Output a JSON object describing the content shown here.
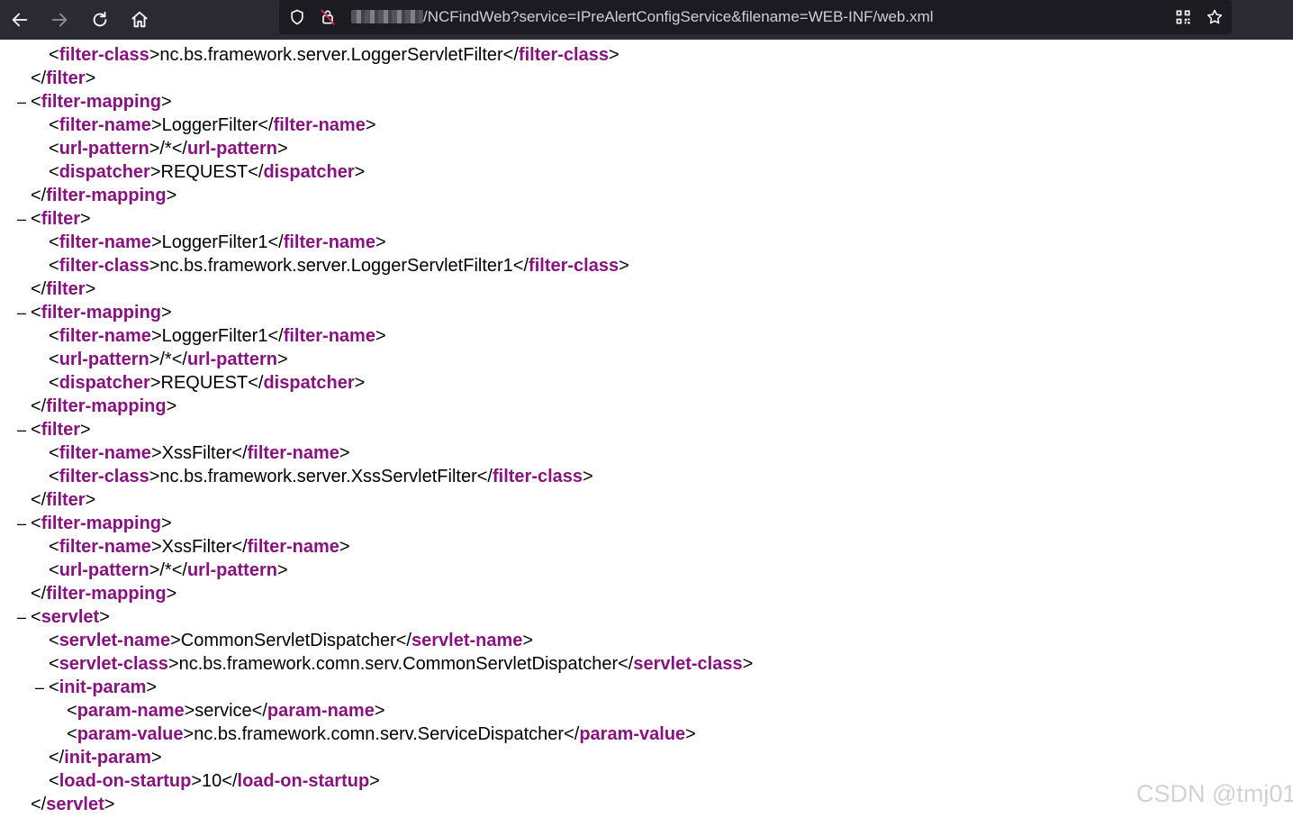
{
  "browser": {
    "url_prefix_redacted": "",
    "url": "/NCFindWeb?service=IPreAlertConfigService&filename=WEB-INF/web.xml"
  },
  "icons": [
    "back-arrow-icon",
    "forward-arrow-icon",
    "reload-icon",
    "home-icon",
    "shield-icon",
    "lock-crossed-icon",
    "qr-code-icon",
    "bookmark-star-icon"
  ],
  "xml_lines": [
    {
      "indent": 1,
      "fold": "",
      "parts": [
        [
          "t",
          "<"
        ],
        [
          "g",
          "filter-class"
        ],
        [
          "t",
          ">nc.bs.framework.server.LoggerServletFilter</"
        ],
        [
          "g",
          "filter-class"
        ],
        [
          "t",
          ">"
        ]
      ]
    },
    {
      "indent": 0,
      "fold": "",
      "parts": [
        [
          "t",
          "</"
        ],
        [
          "g",
          "filter"
        ],
        [
          "t",
          ">"
        ]
      ]
    },
    {
      "indent": 0,
      "fold": "–",
      "parts": [
        [
          "t",
          "<"
        ],
        [
          "g",
          "filter-mapping"
        ],
        [
          "t",
          ">"
        ]
      ]
    },
    {
      "indent": 1,
      "fold": "",
      "parts": [
        [
          "t",
          "<"
        ],
        [
          "g",
          "filter-name"
        ],
        [
          "t",
          ">LoggerFilter</"
        ],
        [
          "g",
          "filter-name"
        ],
        [
          "t",
          ">"
        ]
      ]
    },
    {
      "indent": 1,
      "fold": "",
      "parts": [
        [
          "t",
          "<"
        ],
        [
          "g",
          "url-pattern"
        ],
        [
          "t",
          ">/*</"
        ],
        [
          "g",
          "url-pattern"
        ],
        [
          "t",
          ">"
        ]
      ]
    },
    {
      "indent": 1,
      "fold": "",
      "parts": [
        [
          "t",
          "<"
        ],
        [
          "g",
          "dispatcher"
        ],
        [
          "t",
          ">REQUEST</"
        ],
        [
          "g",
          "dispatcher"
        ],
        [
          "t",
          ">"
        ]
      ]
    },
    {
      "indent": 0,
      "fold": "",
      "parts": [
        [
          "t",
          "</"
        ],
        [
          "g",
          "filter-mapping"
        ],
        [
          "t",
          ">"
        ]
      ]
    },
    {
      "indent": 0,
      "fold": "–",
      "parts": [
        [
          "t",
          "<"
        ],
        [
          "g",
          "filter"
        ],
        [
          "t",
          ">"
        ]
      ]
    },
    {
      "indent": 1,
      "fold": "",
      "parts": [
        [
          "t",
          "<"
        ],
        [
          "g",
          "filter-name"
        ],
        [
          "t",
          ">LoggerFilter1</"
        ],
        [
          "g",
          "filter-name"
        ],
        [
          "t",
          ">"
        ]
      ]
    },
    {
      "indent": 1,
      "fold": "",
      "parts": [
        [
          "t",
          "<"
        ],
        [
          "g",
          "filter-class"
        ],
        [
          "t",
          ">nc.bs.framework.server.LoggerServletFilter1</"
        ],
        [
          "g",
          "filter-class"
        ],
        [
          "t",
          ">"
        ]
      ]
    },
    {
      "indent": 0,
      "fold": "",
      "parts": [
        [
          "t",
          "</"
        ],
        [
          "g",
          "filter"
        ],
        [
          "t",
          ">"
        ]
      ]
    },
    {
      "indent": 0,
      "fold": "–",
      "parts": [
        [
          "t",
          "<"
        ],
        [
          "g",
          "filter-mapping"
        ],
        [
          "t",
          ">"
        ]
      ]
    },
    {
      "indent": 1,
      "fold": "",
      "parts": [
        [
          "t",
          "<"
        ],
        [
          "g",
          "filter-name"
        ],
        [
          "t",
          ">LoggerFilter1</"
        ],
        [
          "g",
          "filter-name"
        ],
        [
          "t",
          ">"
        ]
      ]
    },
    {
      "indent": 1,
      "fold": "",
      "parts": [
        [
          "t",
          "<"
        ],
        [
          "g",
          "url-pattern"
        ],
        [
          "t",
          ">/*</"
        ],
        [
          "g",
          "url-pattern"
        ],
        [
          "t",
          ">"
        ]
      ]
    },
    {
      "indent": 1,
      "fold": "",
      "parts": [
        [
          "t",
          "<"
        ],
        [
          "g",
          "dispatcher"
        ],
        [
          "t",
          ">REQUEST</"
        ],
        [
          "g",
          "dispatcher"
        ],
        [
          "t",
          ">"
        ]
      ]
    },
    {
      "indent": 0,
      "fold": "",
      "parts": [
        [
          "t",
          "</"
        ],
        [
          "g",
          "filter-mapping"
        ],
        [
          "t",
          ">"
        ]
      ]
    },
    {
      "indent": 0,
      "fold": "–",
      "parts": [
        [
          "t",
          "<"
        ],
        [
          "g",
          "filter"
        ],
        [
          "t",
          ">"
        ]
      ]
    },
    {
      "indent": 1,
      "fold": "",
      "parts": [
        [
          "t",
          "<"
        ],
        [
          "g",
          "filter-name"
        ],
        [
          "t",
          ">XssFilter</"
        ],
        [
          "g",
          "filter-name"
        ],
        [
          "t",
          ">"
        ]
      ]
    },
    {
      "indent": 1,
      "fold": "",
      "parts": [
        [
          "t",
          "<"
        ],
        [
          "g",
          "filter-class"
        ],
        [
          "t",
          ">nc.bs.framework.server.XssServletFilter</"
        ],
        [
          "g",
          "filter-class"
        ],
        [
          "t",
          ">"
        ]
      ]
    },
    {
      "indent": 0,
      "fold": "",
      "parts": [
        [
          "t",
          "</"
        ],
        [
          "g",
          "filter"
        ],
        [
          "t",
          ">"
        ]
      ]
    },
    {
      "indent": 0,
      "fold": "–",
      "parts": [
        [
          "t",
          "<"
        ],
        [
          "g",
          "filter-mapping"
        ],
        [
          "t",
          ">"
        ]
      ]
    },
    {
      "indent": 1,
      "fold": "",
      "parts": [
        [
          "t",
          "<"
        ],
        [
          "g",
          "filter-name"
        ],
        [
          "t",
          ">XssFilter</"
        ],
        [
          "g",
          "filter-name"
        ],
        [
          "t",
          ">"
        ]
      ]
    },
    {
      "indent": 1,
      "fold": "",
      "parts": [
        [
          "t",
          "<"
        ],
        [
          "g",
          "url-pattern"
        ],
        [
          "t",
          ">/*</"
        ],
        [
          "g",
          "url-pattern"
        ],
        [
          "t",
          ">"
        ]
      ]
    },
    {
      "indent": 0,
      "fold": "",
      "parts": [
        [
          "t",
          "</"
        ],
        [
          "g",
          "filter-mapping"
        ],
        [
          "t",
          ">"
        ]
      ]
    },
    {
      "indent": 0,
      "fold": "–",
      "parts": [
        [
          "t",
          "<"
        ],
        [
          "g",
          "servlet"
        ],
        [
          "t",
          ">"
        ]
      ]
    },
    {
      "indent": 1,
      "fold": "",
      "parts": [
        [
          "t",
          "<"
        ],
        [
          "g",
          "servlet-name"
        ],
        [
          "t",
          ">CommonServletDispatcher</"
        ],
        [
          "g",
          "servlet-name"
        ],
        [
          "t",
          ">"
        ]
      ]
    },
    {
      "indent": 1,
      "fold": "",
      "parts": [
        [
          "t",
          "<"
        ],
        [
          "g",
          "servlet-class"
        ],
        [
          "t",
          ">nc.bs.framework.comn.serv.CommonServletDispatcher</"
        ],
        [
          "g",
          "servlet-class"
        ],
        [
          "t",
          ">"
        ]
      ]
    },
    {
      "indent": 1,
      "fold": "–",
      "parts": [
        [
          "t",
          "<"
        ],
        [
          "g",
          "init-param"
        ],
        [
          "t",
          ">"
        ]
      ]
    },
    {
      "indent": 2,
      "fold": "",
      "parts": [
        [
          "t",
          "<"
        ],
        [
          "g",
          "param-name"
        ],
        [
          "t",
          ">service</"
        ],
        [
          "g",
          "param-name"
        ],
        [
          "t",
          ">"
        ]
      ]
    },
    {
      "indent": 2,
      "fold": "",
      "parts": [
        [
          "t",
          "<"
        ],
        [
          "g",
          "param-value"
        ],
        [
          "t",
          ">nc.bs.framework.comn.serv.ServiceDispatcher</"
        ],
        [
          "g",
          "param-value"
        ],
        [
          "t",
          ">"
        ]
      ]
    },
    {
      "indent": 1,
      "fold": "",
      "parts": [
        [
          "t",
          "</"
        ],
        [
          "g",
          "init-param"
        ],
        [
          "t",
          ">"
        ]
      ]
    },
    {
      "indent": 1,
      "fold": "",
      "parts": [
        [
          "t",
          "<"
        ],
        [
          "g",
          "load-on-startup"
        ],
        [
          "t",
          ">10</"
        ],
        [
          "g",
          "load-on-startup"
        ],
        [
          "t",
          ">"
        ]
      ]
    },
    {
      "indent": 0,
      "fold": "",
      "parts": [
        [
          "t",
          "</"
        ],
        [
          "g",
          "servlet"
        ],
        [
          "t",
          ">"
        ]
      ]
    }
  ],
  "watermark": "CSDN @tmj01",
  "colors": {
    "toolbar_bg": "#2b2a33",
    "urlbar_bg": "#1c1b22",
    "tag": "#881280",
    "text": "#000000",
    "watermark": "#d2d2d2"
  }
}
